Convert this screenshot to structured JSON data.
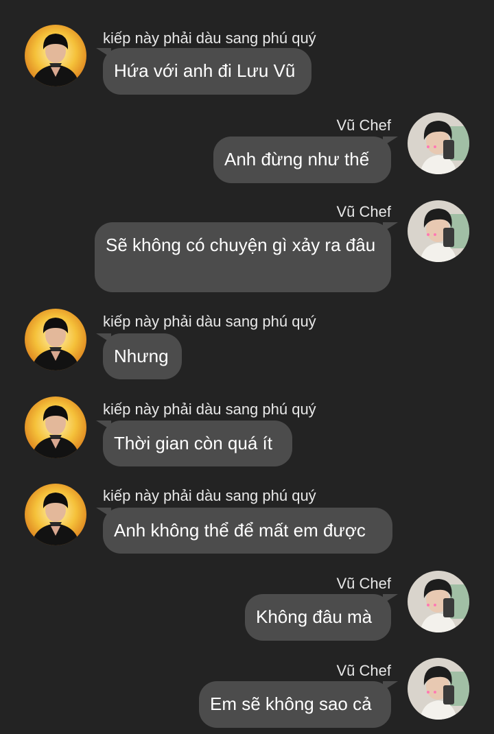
{
  "participants": {
    "other": {
      "name": "kiếp này phải dàu sang phú quý",
      "avatar_icon": "user-avatar-black-hat"
    },
    "me": {
      "name": "Vũ Chef",
      "avatar_icon": "user-avatar-selfie"
    }
  },
  "messages": [
    {
      "side": "recv",
      "sender": "kiếp này phải dàu sang phú quý",
      "text": "Hứa với anh đi Lưu Vũ"
    },
    {
      "side": "sent",
      "sender": "Vũ Chef",
      "text": "Anh đừng như thế"
    },
    {
      "side": "sent",
      "sender": "Vũ Chef",
      "text": "Sẽ không có chuyện gì xảy ra đâu"
    },
    {
      "side": "recv",
      "sender": "kiếp này phải dàu sang phú quý",
      "text": "Nhưng"
    },
    {
      "side": "recv",
      "sender": "kiếp này phải dàu sang phú quý",
      "text": "Thời gian còn quá ít"
    },
    {
      "side": "recv",
      "sender": "kiếp này phải dàu sang phú quý",
      "text": "Anh không thể để mất em được"
    },
    {
      "side": "sent",
      "sender": "Vũ Chef",
      "text": "Không đâu mà"
    },
    {
      "side": "sent",
      "sender": "Vũ Chef",
      "text": "Em sẽ không sao cả"
    }
  ],
  "colors": {
    "background": "#232323",
    "bubble": "#4c4c4c",
    "text": "#ffffff"
  }
}
